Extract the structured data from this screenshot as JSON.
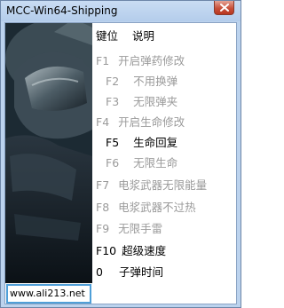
{
  "window": {
    "title": "MCC-Win64-Shipping"
  },
  "header": {
    "key_label": "键位",
    "desc_label": "说明"
  },
  "hotkeys": [
    {
      "key": "F1",
      "desc": "开启弹药修改",
      "active": false
    },
    {
      "key": "F2",
      "desc": "不用换弹",
      "active": false
    },
    {
      "key": "F3",
      "desc": "无限弹夹",
      "active": false
    },
    {
      "key": "F4",
      "desc": "开启生命修改",
      "active": false
    },
    {
      "key": "F5",
      "desc": "生命回复",
      "active": true
    },
    {
      "key": "F6",
      "desc": "无限生命",
      "active": false
    },
    {
      "key": "F7",
      "desc": "电浆武器无限能量",
      "active": false
    },
    {
      "key": "F8",
      "desc": "电浆武器不过热",
      "active": false
    },
    {
      "key": "F9",
      "desc": "无限手雷",
      "active": false
    },
    {
      "key": "F10",
      "desc": "超级速度",
      "active": true
    },
    {
      "key": "0",
      "desc": "子弹时间",
      "active": true
    }
  ],
  "footer": {
    "url": "www.ali213.net"
  },
  "colors": {
    "inactive_text": "#9a9a9a",
    "active_text": "#000000",
    "frame": "#bcd3ee",
    "url_border": "#4f9fd8"
  }
}
